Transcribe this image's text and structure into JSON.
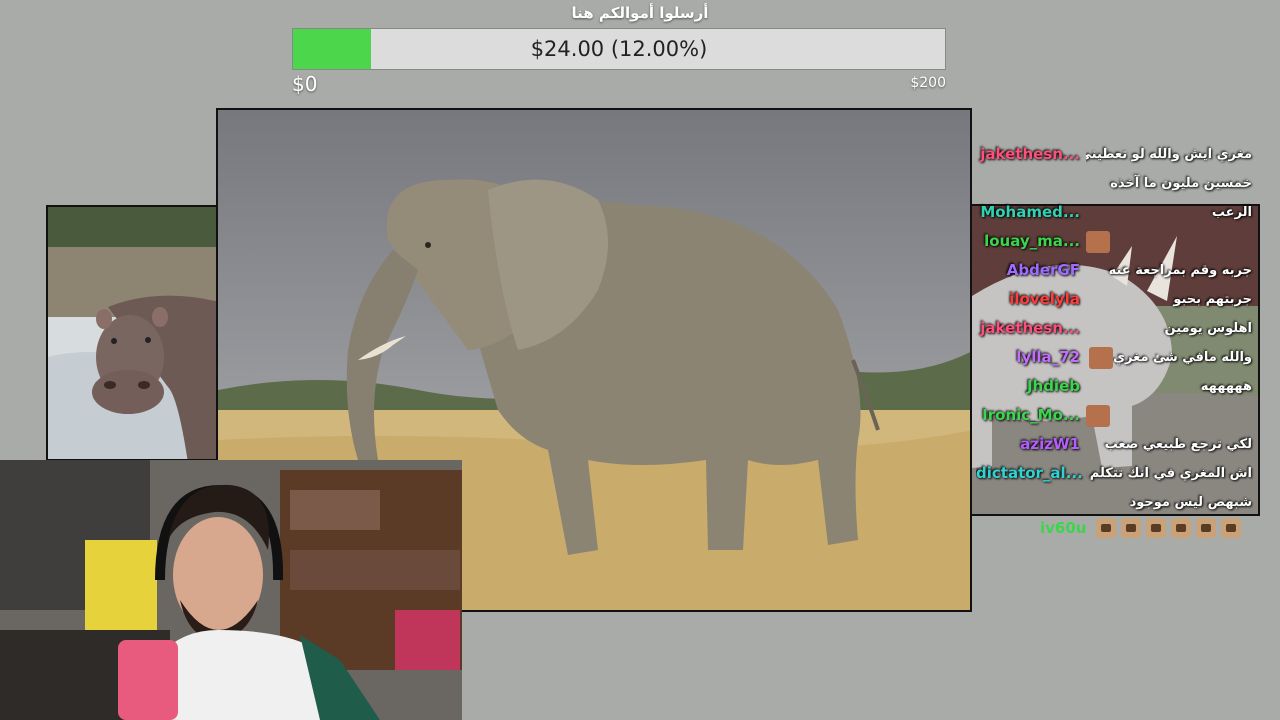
{
  "goal": {
    "title": "أرسلوا أموالكم هنا",
    "amount_label": "$24.00 (12.00%)",
    "progress_fraction": 0.12,
    "min_label": "$0",
    "max_label": "$200",
    "fill_color": "#4cd64c"
  },
  "media": {
    "left_image": "hippo",
    "main_image": "elephant",
    "right_image": "rhino",
    "webcam": "streamer-webcam"
  },
  "chat": {
    "messages": [
      {
        "user": "jakethesn...",
        "color": "#ff4f7a",
        "text": "مغري ايش والله لو تعطيني"
      },
      {
        "user": "",
        "color": "#ffffff",
        "text": "خمسين مليون ما آخذه"
      },
      {
        "user": "Mohamed...",
        "color": "#2fd3b4",
        "text": "الرعب"
      },
      {
        "user": "louay_ma...",
        "color": "#3cd64c",
        "text": "",
        "emote": "face-emote"
      },
      {
        "user": "AbderGF",
        "color": "#a06cff",
        "text": "جربه وقم بمراجعة عنه"
      },
      {
        "user": "ilovelyla",
        "color": "#ff3d3d",
        "text": "جربتهم بحبو"
      },
      {
        "user": "jakethesn...",
        "color": "#ff4f7a",
        "text": "اهلوس يومين"
      },
      {
        "user": "lylla_72",
        "color": "#c46cff",
        "text": "والله مافي شئ مغري",
        "emote": "face-emote"
      },
      {
        "user": "Jhdieb",
        "color": "#3cd64c",
        "text": "هههههه"
      },
      {
        "user": "Ironic_Mo...",
        "color": "#3cd64c",
        "text": "",
        "emote": "face-emote"
      },
      {
        "user": "azizW1",
        "color": "#b75cff",
        "text": "لكي ترجع طبيعي صعب"
      },
      {
        "user": "dictator_al...",
        "color": "#2fd3d3",
        "text": "اش المغري في انك تتكلم مع"
      },
      {
        "user": "",
        "color": "#ffffff",
        "text": "شبهص ليس موجود"
      }
    ],
    "last": {
      "user": "iv60u",
      "color": "#3cd64c",
      "emote_count": 6,
      "emote": "box-cat-emote"
    }
  }
}
